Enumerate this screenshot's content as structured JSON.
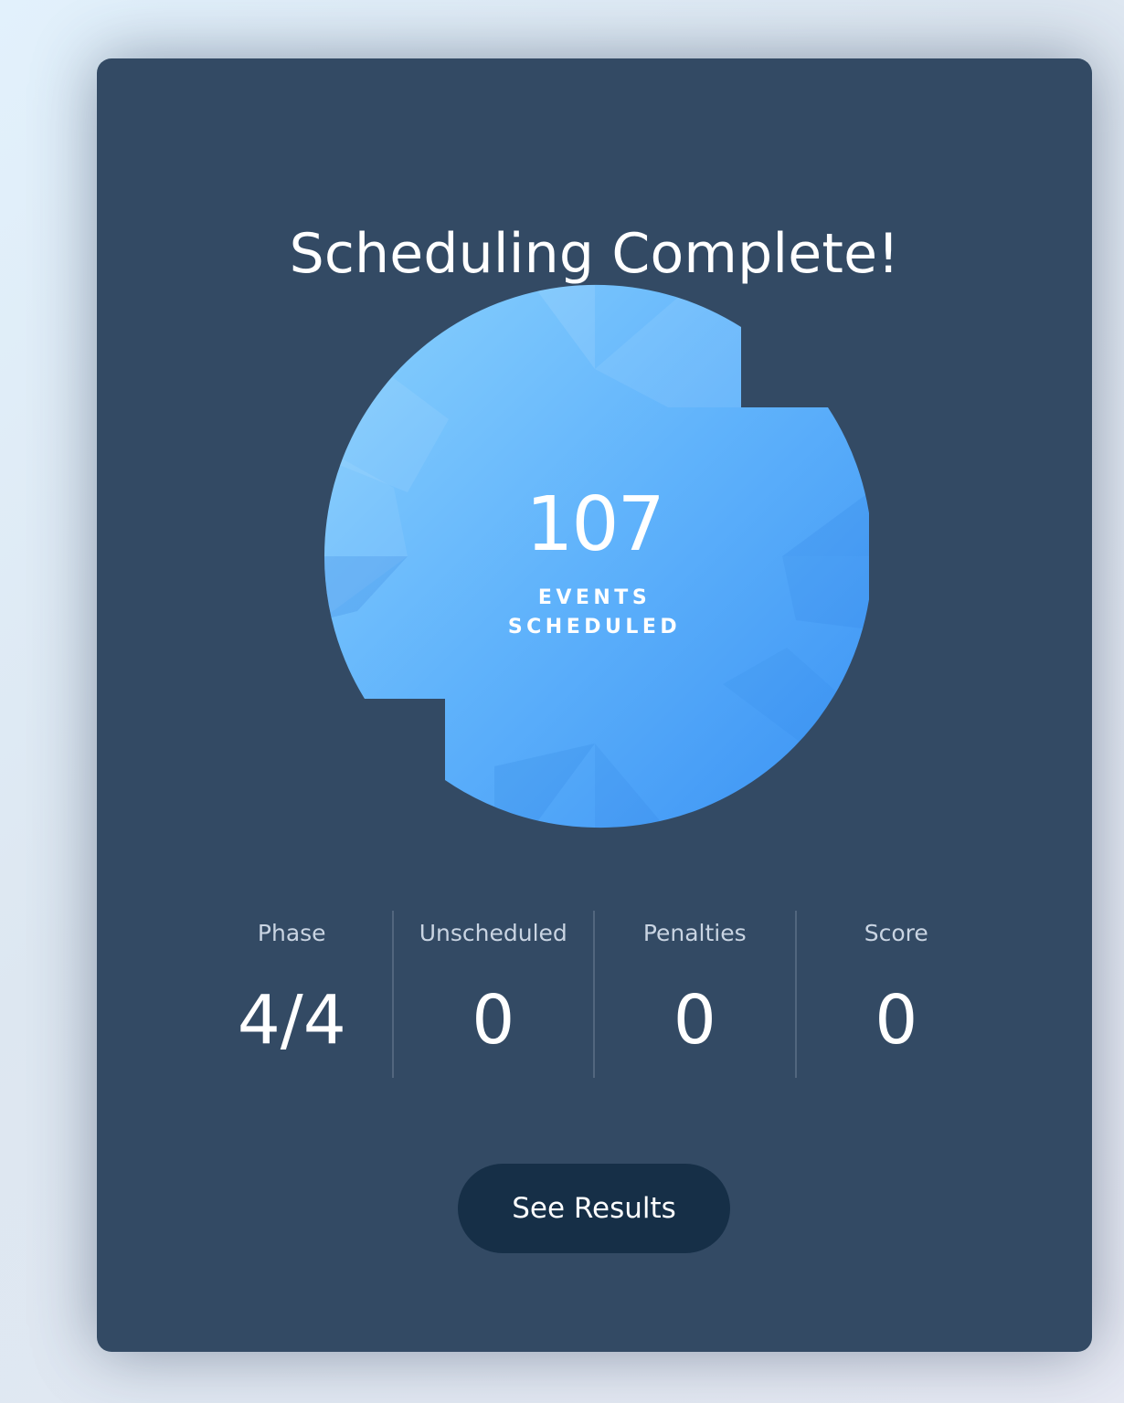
{
  "dialog": {
    "title": "Scheduling Complete!",
    "count": "107",
    "count_label": "EVENTS SCHEDULED",
    "progress_fraction": 1.0
  },
  "stats": [
    {
      "label": "Phase",
      "value": "4/4"
    },
    {
      "label": "Unscheduled",
      "value": "0"
    },
    {
      "label": "Penalties",
      "value": "0"
    },
    {
      "label": "Score",
      "value": "0"
    }
  ],
  "actions": {
    "see_results_label": "See Results"
  },
  "colors": {
    "card_background": "#334a64",
    "ring_light": "#7dcbfc",
    "ring_dark": "#3f97f4",
    "button_background": "#162f47"
  }
}
